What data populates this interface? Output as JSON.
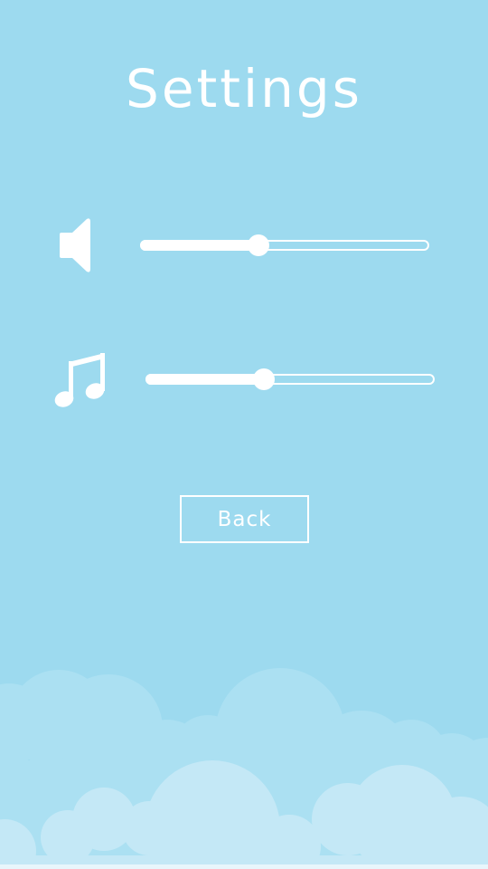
{
  "screen": {
    "title": "Settings",
    "background_color": "#9ddaef",
    "foreground_color": "#ffffff"
  },
  "sound_setting": {
    "icon": "speaker-icon",
    "level": 0.41
  },
  "music_setting": {
    "icon": "music-note-icon",
    "level": 0.41
  },
  "back_button": {
    "label": "Back"
  },
  "clouds": {
    "back_color": "#abe0f2",
    "front_color": "#c4e8f6"
  }
}
